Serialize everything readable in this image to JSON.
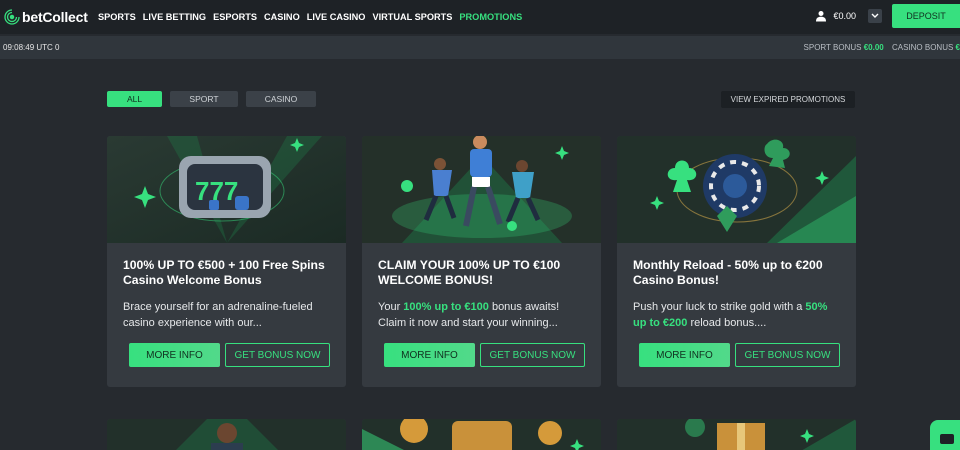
{
  "brand": {
    "name": "betCollect",
    "accent": "#37e07f"
  },
  "nav": {
    "items": [
      {
        "label": "SPORTS",
        "active": false
      },
      {
        "label": "LIVE BETTING",
        "active": false
      },
      {
        "label": "ESPORTS",
        "active": false
      },
      {
        "label": "CASINO",
        "active": false
      },
      {
        "label": "LIVE CASINO",
        "active": false
      },
      {
        "label": "VIRTUAL SPORTS",
        "active": false
      },
      {
        "label": "PROMOTIONS",
        "active": true
      }
    ]
  },
  "account": {
    "balance": "€0.00",
    "icon": "user-icon",
    "deposit_label": "DEPOSIT"
  },
  "status": {
    "clock": "09:08:49 UTC 0",
    "sport_bonus_label": "SPORT BONUS",
    "sport_bonus_value": "€0.00",
    "casino_bonus_label": "CASINO BONUS",
    "casino_bonus_value": "€"
  },
  "filters": {
    "tabs": [
      {
        "label": "ALL",
        "active": true
      },
      {
        "label": "SPORT",
        "active": false
      },
      {
        "label": "CASINO",
        "active": false
      }
    ],
    "expired_label": "VIEW EXPIRED PROMOTIONS"
  },
  "promotions": [
    {
      "title": "100% UP TO €500 + 100 Free Spins Casino Welcome Bonus",
      "desc_parts": [
        "Brace yourself for an adrenaline-fueled casino experience with our...",
        "",
        ""
      ],
      "more_label": "MORE INFO",
      "get_label": "GET BONUS NOW"
    },
    {
      "title": "CLAIM YOUR 100% UP TO €100 WELCOME BONUS!",
      "desc_parts": [
        "Your ",
        "100% up to €100",
        " bonus awaits! Claim it now and start your winning..."
      ],
      "more_label": "MORE INFO",
      "get_label": "GET BONUS NOW"
    },
    {
      "title": "Monthly Reload - 50% up to €200 Casino Bonus!",
      "desc_parts": [
        "Push your luck to strike gold with a ",
        "50% up to €200",
        " reload bonus...."
      ],
      "more_label": "MORE INFO",
      "get_label": "GET BONUS NOW"
    }
  ]
}
